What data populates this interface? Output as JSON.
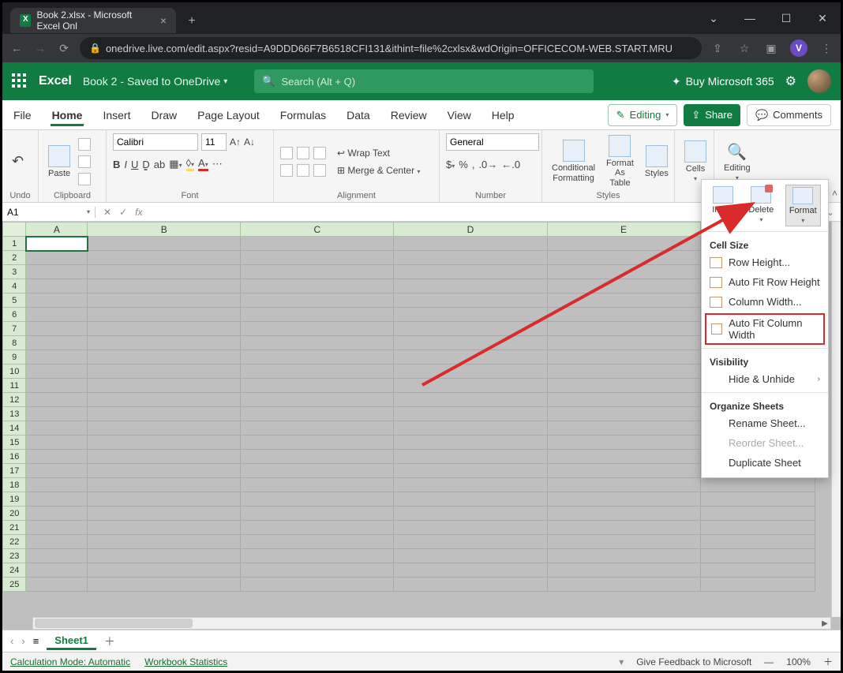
{
  "window": {
    "tab_title": "Book 2.xlsx - Microsoft Excel Onl",
    "url": "onedrive.live.com/edit.aspx?resid=A9DDD66F7B6518CFI131&ithint=file%2cxlsx&wdOrigin=OFFICECOM-WEB.START.MRU",
    "avatar_letter": "V"
  },
  "header": {
    "brand": "Excel",
    "doc": "Book 2 ",
    "saved": "- Saved to OneDrive",
    "search_placeholder": "Search (Alt + Q)",
    "buy": "Buy Microsoft 365"
  },
  "tabs": {
    "file": "File",
    "home": "Home",
    "insert": "Insert",
    "draw": "Draw",
    "page_layout": "Page Layout",
    "formulas": "Formulas",
    "data": "Data",
    "review": "Review",
    "view": "View",
    "help": "Help",
    "editing": "Editing",
    "share": "Share",
    "comments": "Comments"
  },
  "ribbon": {
    "undo": "Undo",
    "paste": "Paste",
    "clipboard": "Clipboard",
    "font": "Font",
    "font_name": "Calibri",
    "font_size": "11",
    "alignment": "Alignment",
    "wrap": "Wrap Text",
    "merge": "Merge & Center",
    "number": "Number",
    "number_format": "General",
    "styles": "Styles",
    "cond_fmt": "Conditional Formatting",
    "fmt_table": "Format As Table",
    "styles_btn": "Styles",
    "cells": "Cells",
    "editing_grp": "Editing"
  },
  "fx": {
    "namebox": "A1",
    "fx": "fx"
  },
  "columns": [
    "A",
    "B",
    "C",
    "D",
    "E"
  ],
  "rows": [
    "1",
    "2",
    "3",
    "4",
    "5",
    "6",
    "7",
    "8",
    "9",
    "10",
    "11",
    "12",
    "13",
    "14",
    "15",
    "16",
    "17",
    "18",
    "19",
    "20",
    "21",
    "22",
    "23",
    "24",
    "25"
  ],
  "popup": {
    "insert": "Insert",
    "delete": "Delete",
    "format": "Format",
    "cell_size": "Cell Size",
    "row_height": "Row Height...",
    "autofit_row": "Auto Fit Row Height",
    "col_width": "Column Width...",
    "autofit_col": "Auto Fit Column Width",
    "visibility": "Visibility",
    "hide_unhide": "Hide & Unhide",
    "organize": "Organize Sheets",
    "rename": "Rename Sheet...",
    "reorder": "Reorder Sheet...",
    "duplicate": "Duplicate Sheet"
  },
  "sheets": {
    "sheet1": "Sheet1"
  },
  "status": {
    "calc": "Calculation Mode: Automatic",
    "stats": "Workbook Statistics",
    "feedback": "Give Feedback to Microsoft",
    "zoom": "100%"
  }
}
